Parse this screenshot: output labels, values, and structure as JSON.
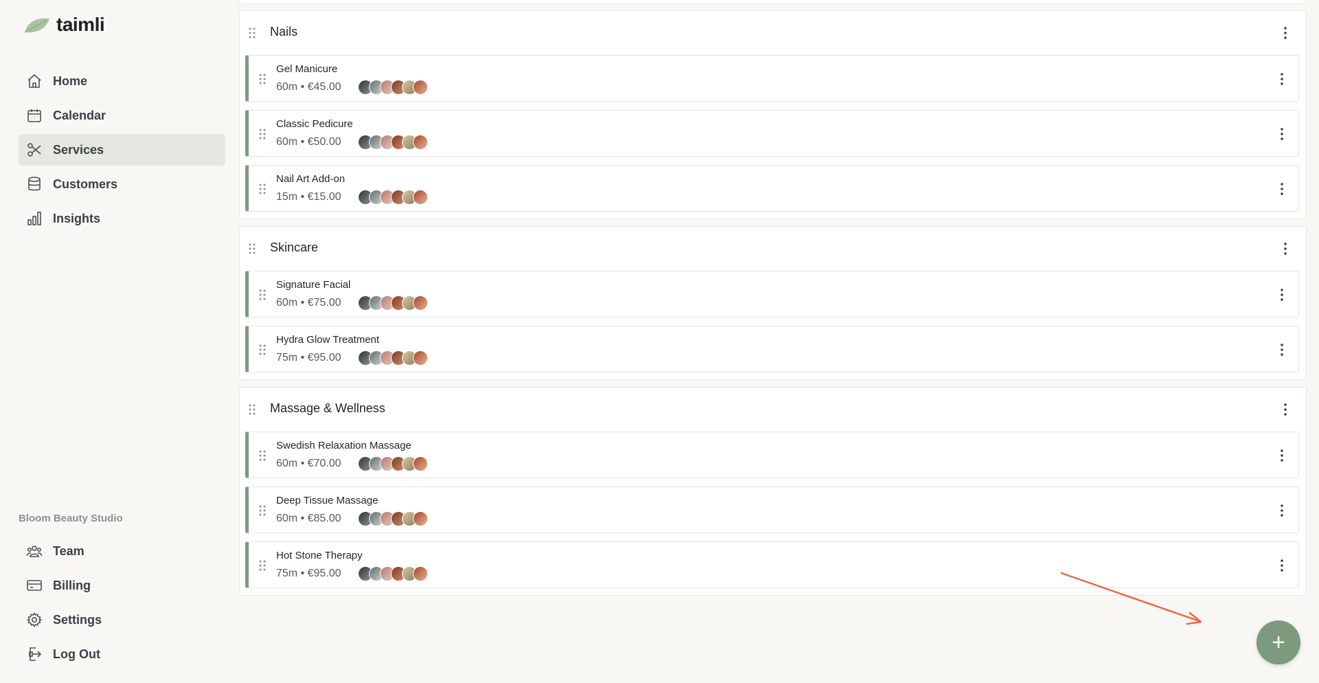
{
  "app": {
    "name": "taimli"
  },
  "sidebar": {
    "nav": [
      {
        "label": "Home",
        "icon": "home-icon"
      },
      {
        "label": "Calendar",
        "icon": "calendar-icon"
      },
      {
        "label": "Services",
        "icon": "scissors-icon",
        "active": true
      },
      {
        "label": "Customers",
        "icon": "database-icon"
      },
      {
        "label": "Insights",
        "icon": "bar-chart-icon"
      }
    ],
    "studio_name": "Bloom Beauty Studio",
    "bottom_nav": [
      {
        "label": "Team",
        "icon": "users-icon"
      },
      {
        "label": "Billing",
        "icon": "credit-card-icon"
      },
      {
        "label": "Settings",
        "icon": "gear-icon"
      },
      {
        "label": "Log Out",
        "icon": "logout-icon"
      }
    ]
  },
  "groups": [
    {
      "title": "Nails",
      "services": [
        {
          "name": "Gel Manicure",
          "meta": "60m • €45.00"
        },
        {
          "name": "Classic Pedicure",
          "meta": "60m • €50.00"
        },
        {
          "name": "Nail Art Add-on",
          "meta": "15m • €15.00"
        }
      ]
    },
    {
      "title": "Skincare",
      "services": [
        {
          "name": "Signature Facial",
          "meta": "60m • €75.00"
        },
        {
          "name": "Hydra Glow Treatment",
          "meta": "75m • €95.00"
        }
      ]
    },
    {
      "title": "Massage & Wellness",
      "services": [
        {
          "name": "Swedish Relaxation Massage",
          "meta": "60m • €70.00"
        },
        {
          "name": "Deep Tissue Massage",
          "meta": "60m • €85.00"
        },
        {
          "name": "Hot Stone Therapy",
          "meta": "75m • €95.00"
        }
      ]
    }
  ],
  "colors": {
    "accent": "#7d9a7f",
    "arrow": "#f0663e",
    "active_nav_bg": "#e4e8e1"
  },
  "fab": {
    "icon": "plus-icon"
  }
}
